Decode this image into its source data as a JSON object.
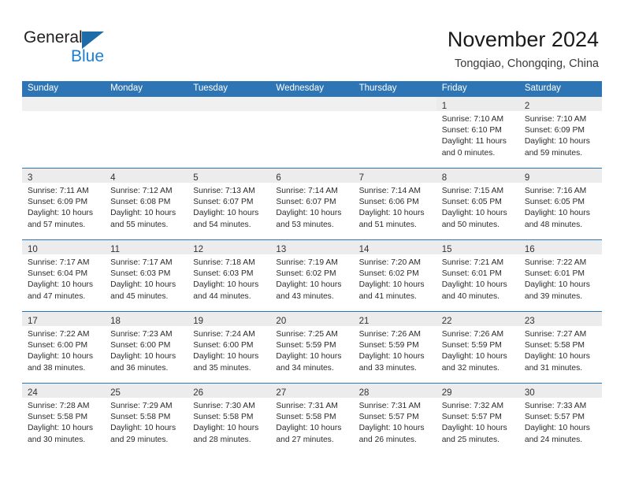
{
  "brand": {
    "name_top": "General",
    "name_bottom": "Blue",
    "triangle_icon": "blue-triangle-logo-icon",
    "accent_color": "#1b7fd4"
  },
  "header": {
    "title": "November 2024",
    "subtitle": "Tongqiao, Chongqing, China"
  },
  "theme": {
    "header_blue": "#2e75b6",
    "daynum_strip": "#f0f0f0",
    "text": "#2b2b2b"
  },
  "weekdays": [
    "Sunday",
    "Monday",
    "Tuesday",
    "Wednesday",
    "Thursday",
    "Friday",
    "Saturday"
  ],
  "weeks": [
    [
      {
        "day": "",
        "sunrise": "",
        "sunset": "",
        "daylight1": "",
        "daylight2": "",
        "empty": true
      },
      {
        "day": "",
        "sunrise": "",
        "sunset": "",
        "daylight1": "",
        "daylight2": "",
        "empty": true
      },
      {
        "day": "",
        "sunrise": "",
        "sunset": "",
        "daylight1": "",
        "daylight2": "",
        "empty": true
      },
      {
        "day": "",
        "sunrise": "",
        "sunset": "",
        "daylight1": "",
        "daylight2": "",
        "empty": true
      },
      {
        "day": "",
        "sunrise": "",
        "sunset": "",
        "daylight1": "",
        "daylight2": "",
        "empty": true
      },
      {
        "day": "1",
        "sunrise": "Sunrise: 7:10 AM",
        "sunset": "Sunset: 6:10 PM",
        "daylight1": "Daylight: 11 hours",
        "daylight2": "and 0 minutes.",
        "empty": false
      },
      {
        "day": "2",
        "sunrise": "Sunrise: 7:10 AM",
        "sunset": "Sunset: 6:09 PM",
        "daylight1": "Daylight: 10 hours",
        "daylight2": "and 59 minutes.",
        "empty": false
      }
    ],
    [
      {
        "day": "3",
        "sunrise": "Sunrise: 7:11 AM",
        "sunset": "Sunset: 6:09 PM",
        "daylight1": "Daylight: 10 hours",
        "daylight2": "and 57 minutes.",
        "empty": false
      },
      {
        "day": "4",
        "sunrise": "Sunrise: 7:12 AM",
        "sunset": "Sunset: 6:08 PM",
        "daylight1": "Daylight: 10 hours",
        "daylight2": "and 55 minutes.",
        "empty": false
      },
      {
        "day": "5",
        "sunrise": "Sunrise: 7:13 AM",
        "sunset": "Sunset: 6:07 PM",
        "daylight1": "Daylight: 10 hours",
        "daylight2": "and 54 minutes.",
        "empty": false
      },
      {
        "day": "6",
        "sunrise": "Sunrise: 7:14 AM",
        "sunset": "Sunset: 6:07 PM",
        "daylight1": "Daylight: 10 hours",
        "daylight2": "and 53 minutes.",
        "empty": false
      },
      {
        "day": "7",
        "sunrise": "Sunrise: 7:14 AM",
        "sunset": "Sunset: 6:06 PM",
        "daylight1": "Daylight: 10 hours",
        "daylight2": "and 51 minutes.",
        "empty": false
      },
      {
        "day": "8",
        "sunrise": "Sunrise: 7:15 AM",
        "sunset": "Sunset: 6:05 PM",
        "daylight1": "Daylight: 10 hours",
        "daylight2": "and 50 minutes.",
        "empty": false
      },
      {
        "day": "9",
        "sunrise": "Sunrise: 7:16 AM",
        "sunset": "Sunset: 6:05 PM",
        "daylight1": "Daylight: 10 hours",
        "daylight2": "and 48 minutes.",
        "empty": false
      }
    ],
    [
      {
        "day": "10",
        "sunrise": "Sunrise: 7:17 AM",
        "sunset": "Sunset: 6:04 PM",
        "daylight1": "Daylight: 10 hours",
        "daylight2": "and 47 minutes.",
        "empty": false
      },
      {
        "day": "11",
        "sunrise": "Sunrise: 7:17 AM",
        "sunset": "Sunset: 6:03 PM",
        "daylight1": "Daylight: 10 hours",
        "daylight2": "and 45 minutes.",
        "empty": false
      },
      {
        "day": "12",
        "sunrise": "Sunrise: 7:18 AM",
        "sunset": "Sunset: 6:03 PM",
        "daylight1": "Daylight: 10 hours",
        "daylight2": "and 44 minutes.",
        "empty": false
      },
      {
        "day": "13",
        "sunrise": "Sunrise: 7:19 AM",
        "sunset": "Sunset: 6:02 PM",
        "daylight1": "Daylight: 10 hours",
        "daylight2": "and 43 minutes.",
        "empty": false
      },
      {
        "day": "14",
        "sunrise": "Sunrise: 7:20 AM",
        "sunset": "Sunset: 6:02 PM",
        "daylight1": "Daylight: 10 hours",
        "daylight2": "and 41 minutes.",
        "empty": false
      },
      {
        "day": "15",
        "sunrise": "Sunrise: 7:21 AM",
        "sunset": "Sunset: 6:01 PM",
        "daylight1": "Daylight: 10 hours",
        "daylight2": "and 40 minutes.",
        "empty": false
      },
      {
        "day": "16",
        "sunrise": "Sunrise: 7:22 AM",
        "sunset": "Sunset: 6:01 PM",
        "daylight1": "Daylight: 10 hours",
        "daylight2": "and 39 minutes.",
        "empty": false
      }
    ],
    [
      {
        "day": "17",
        "sunrise": "Sunrise: 7:22 AM",
        "sunset": "Sunset: 6:00 PM",
        "daylight1": "Daylight: 10 hours",
        "daylight2": "and 38 minutes.",
        "empty": false
      },
      {
        "day": "18",
        "sunrise": "Sunrise: 7:23 AM",
        "sunset": "Sunset: 6:00 PM",
        "daylight1": "Daylight: 10 hours",
        "daylight2": "and 36 minutes.",
        "empty": false
      },
      {
        "day": "19",
        "sunrise": "Sunrise: 7:24 AM",
        "sunset": "Sunset: 6:00 PM",
        "daylight1": "Daylight: 10 hours",
        "daylight2": "and 35 minutes.",
        "empty": false
      },
      {
        "day": "20",
        "sunrise": "Sunrise: 7:25 AM",
        "sunset": "Sunset: 5:59 PM",
        "daylight1": "Daylight: 10 hours",
        "daylight2": "and 34 minutes.",
        "empty": false
      },
      {
        "day": "21",
        "sunrise": "Sunrise: 7:26 AM",
        "sunset": "Sunset: 5:59 PM",
        "daylight1": "Daylight: 10 hours",
        "daylight2": "and 33 minutes.",
        "empty": false
      },
      {
        "day": "22",
        "sunrise": "Sunrise: 7:26 AM",
        "sunset": "Sunset: 5:59 PM",
        "daylight1": "Daylight: 10 hours",
        "daylight2": "and 32 minutes.",
        "empty": false
      },
      {
        "day": "23",
        "sunrise": "Sunrise: 7:27 AM",
        "sunset": "Sunset: 5:58 PM",
        "daylight1": "Daylight: 10 hours",
        "daylight2": "and 31 minutes.",
        "empty": false
      }
    ],
    [
      {
        "day": "24",
        "sunrise": "Sunrise: 7:28 AM",
        "sunset": "Sunset: 5:58 PM",
        "daylight1": "Daylight: 10 hours",
        "daylight2": "and 30 minutes.",
        "empty": false
      },
      {
        "day": "25",
        "sunrise": "Sunrise: 7:29 AM",
        "sunset": "Sunset: 5:58 PM",
        "daylight1": "Daylight: 10 hours",
        "daylight2": "and 29 minutes.",
        "empty": false
      },
      {
        "day": "26",
        "sunrise": "Sunrise: 7:30 AM",
        "sunset": "Sunset: 5:58 PM",
        "daylight1": "Daylight: 10 hours",
        "daylight2": "and 28 minutes.",
        "empty": false
      },
      {
        "day": "27",
        "sunrise": "Sunrise: 7:31 AM",
        "sunset": "Sunset: 5:58 PM",
        "daylight1": "Daylight: 10 hours",
        "daylight2": "and 27 minutes.",
        "empty": false
      },
      {
        "day": "28",
        "sunrise": "Sunrise: 7:31 AM",
        "sunset": "Sunset: 5:57 PM",
        "daylight1": "Daylight: 10 hours",
        "daylight2": "and 26 minutes.",
        "empty": false
      },
      {
        "day": "29",
        "sunrise": "Sunrise: 7:32 AM",
        "sunset": "Sunset: 5:57 PM",
        "daylight1": "Daylight: 10 hours",
        "daylight2": "and 25 minutes.",
        "empty": false
      },
      {
        "day": "30",
        "sunrise": "Sunrise: 7:33 AM",
        "sunset": "Sunset: 5:57 PM",
        "daylight1": "Daylight: 10 hours",
        "daylight2": "and 24 minutes.",
        "empty": false
      }
    ]
  ]
}
